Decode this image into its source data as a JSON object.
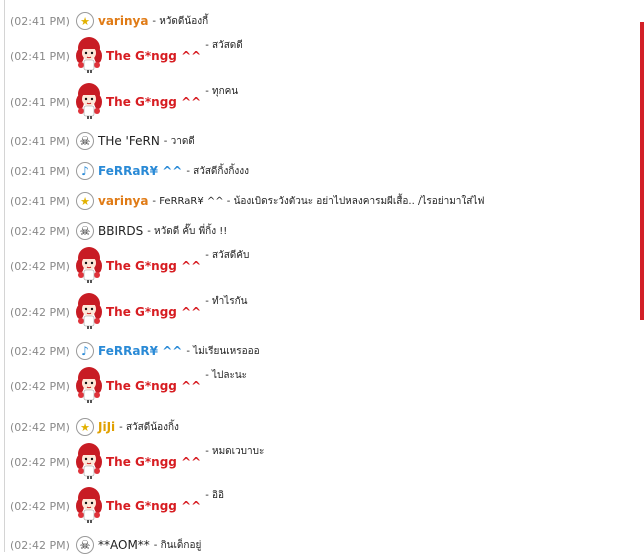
{
  "messages": [
    {
      "time": "(02:41 PM)",
      "user": "varinya",
      "kind": "varinya",
      "icon": "star-icon",
      "text": "- หวัดดีน้องกี้"
    },
    {
      "time": "(02:41 PM)",
      "user": "The G*ngg ^^",
      "kind": "gngg",
      "icon": "avatar",
      "text": "- สวัสดดี"
    },
    {
      "time": "(02:41 PM)",
      "user": "The G*ngg ^^",
      "kind": "gngg",
      "icon": "avatar",
      "text": "- ทุกคน"
    },
    {
      "time": "(02:41 PM)",
      "user": "THe 'FeRN",
      "kind": "plain",
      "icon": "skull-icon",
      "text": "- วาดดี"
    },
    {
      "time": "(02:41 PM)",
      "user": "FeRRaR¥ ^^",
      "kind": "ferrari",
      "icon": "music-note-icon",
      "text": "- สวัสดีกิ้งกิ้งงง"
    },
    {
      "time": "(02:41 PM)",
      "user": "varinya",
      "kind": "varinya",
      "icon": "star-icon",
      "text": "- FeRRaR¥ ^^ - น้องเบิดระวังตัวนะ อย่าไปหลงคารมผีเสื้อ.. /ไรอย่ามาใส่ไฟ"
    },
    {
      "time": "(02:42 PM)",
      "user": "BBIRDS",
      "kind": "plain",
      "icon": "skull-icon",
      "text": "- หวัดดี คั๊บ พี่กิ้ง !!"
    },
    {
      "time": "(02:42 PM)",
      "user": "The G*ngg ^^",
      "kind": "gngg",
      "icon": "avatar",
      "text": "- สวัสดีคับ"
    },
    {
      "time": "(02:42 PM)",
      "user": "The G*ngg ^^",
      "kind": "gngg",
      "icon": "avatar",
      "text": "- ทำไรกัน"
    },
    {
      "time": "(02:42 PM)",
      "user": "FeRRaR¥ ^^",
      "kind": "ferrari",
      "icon": "music-note-icon",
      "text": "- ไม่เรียนเหรอออ"
    },
    {
      "time": "(02:42 PM)",
      "user": "The G*ngg ^^",
      "kind": "gngg",
      "icon": "avatar",
      "text": "- ไปละนะ"
    },
    {
      "time": "(02:42 PM)",
      "user": "JiJi",
      "kind": "jiji",
      "icon": "star-icon",
      "text": "- สวัสดีน้องกิ้ง"
    },
    {
      "time": "(02:42 PM)",
      "user": "The G*ngg ^^",
      "kind": "gngg",
      "icon": "avatar",
      "text": "- หมดเวบาบะ"
    },
    {
      "time": "(02:42 PM)",
      "user": "The G*ngg ^^",
      "kind": "gngg",
      "icon": "avatar",
      "text": "- อิอิ"
    },
    {
      "time": "(02:42 PM)",
      "user": "**AOM**",
      "kind": "plain",
      "icon": "skull-icon",
      "text": "- กินเด็กอยู่"
    }
  ],
  "colors": {
    "gngg": "#d71d22",
    "varinya": "#e07b16",
    "ferrari": "#2a8ad6",
    "scrollbar_accent": "#d32027"
  }
}
